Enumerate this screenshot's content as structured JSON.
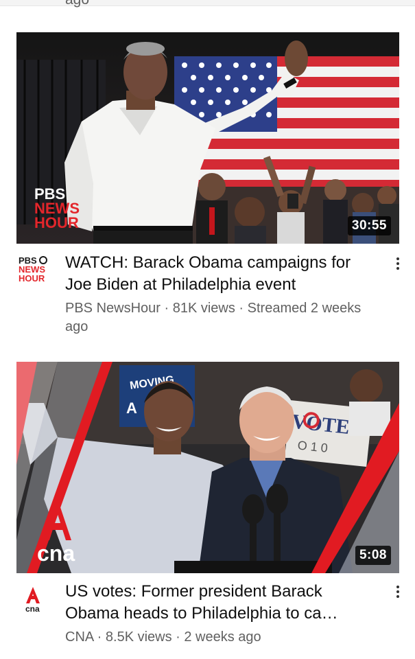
{
  "feed": {
    "previous_card_tail": "ago",
    "videos": [
      {
        "title": "WATCH: Barack Obama campaigns for Joe Biden at Philadelphia event",
        "channel": "PBS NewsHour",
        "views": "81K views",
        "age": "Streamed 2 weeks ago",
        "meta": "PBS NewsHour · 81K views · Streamed 2 weeks ago",
        "duration": "30:55",
        "channel_logo_lines": [
          "PBS",
          "NEWS",
          "HOUR"
        ],
        "thumb_logo_lines": [
          "PBS",
          "NEWS",
          "HOUR"
        ]
      },
      {
        "title": "US votes: Former president Barack Obama heads to Philadelphia to ca…",
        "channel": "CNA",
        "views": "8.5K views",
        "age": "2 weeks ago",
        "meta": "CNA · 8.5K views · 2 weeks ago",
        "duration": "5:08",
        "channel_logo_text": "cna",
        "thumb_logo_text": "cna",
        "thumb_sign_text": "VOTE",
        "thumb_sign_sub": "O 1 0",
        "thumb_banner_text": "MOVING"
      }
    ]
  },
  "colors": {
    "pbs_red": "#e3262b",
    "cna_red": "#e11b22",
    "title": "#0f0f0f",
    "meta": "#606060"
  }
}
